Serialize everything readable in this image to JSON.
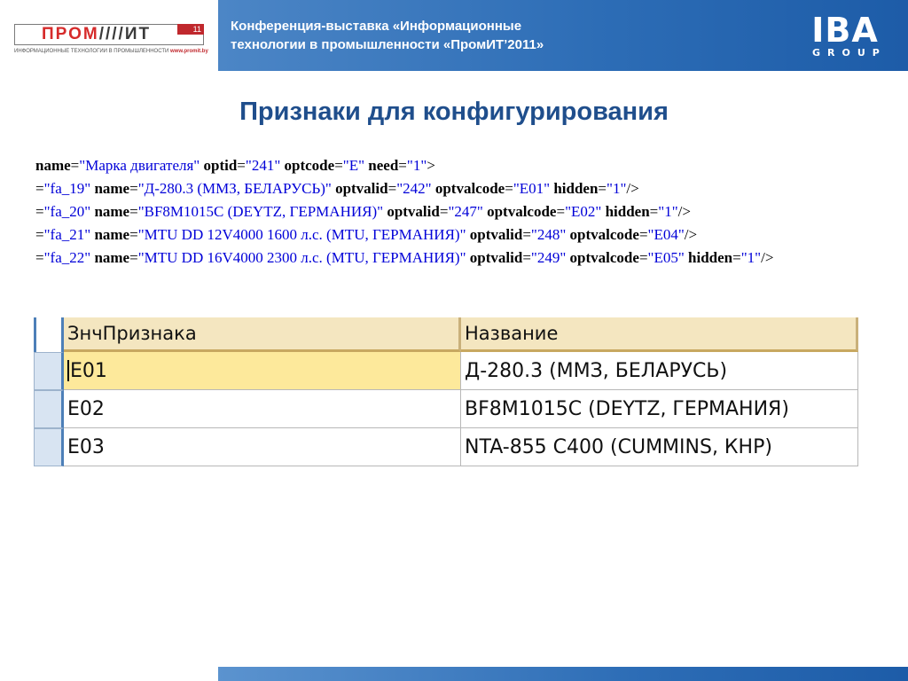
{
  "header": {
    "logo": {
      "word_left": "ПРОМ",
      "word_right": "ИТ",
      "badge": "11",
      "tagline": "ИНФОРМАЦИОННЫЕ ТЕХНОЛОГИИ В ПРОМЫШЛЕННОСТИ",
      "url": "www.promit.by"
    },
    "conference_line1": "Конференция-выставка «Информационные",
    "conference_line2": "технологии в промышленности «ПромИТ’2011»",
    "company_logo_main": "IBA",
    "company_logo_sub": "GROUP"
  },
  "title": "Признаки для конфигурирования",
  "xml_lines": [
    [
      {
        "t": "name",
        "k": "attr"
      },
      {
        "t": "=",
        "k": "pun"
      },
      {
        "t": "\"Марка двигателя\"",
        "k": "val"
      },
      {
        "t": " ",
        "k": "pun"
      },
      {
        "t": "optid",
        "k": "attr"
      },
      {
        "t": "=",
        "k": "pun"
      },
      {
        "t": "\"241\"",
        "k": "val"
      },
      {
        "t": " ",
        "k": "pun"
      },
      {
        "t": "optcode",
        "k": "attr"
      },
      {
        "t": "=",
        "k": "pun"
      },
      {
        "t": "\"E\"",
        "k": "val"
      },
      {
        "t": " ",
        "k": "pun"
      },
      {
        "t": "need",
        "k": "attr"
      },
      {
        "t": "=",
        "k": "pun"
      },
      {
        "t": "\"1\"",
        "k": "val"
      },
      {
        "t": ">",
        "k": "pun"
      }
    ],
    [
      {
        "t": "=",
        "k": "pun"
      },
      {
        "t": "\"fa_19\"",
        "k": "val"
      },
      {
        "t": " ",
        "k": "pun"
      },
      {
        "t": "name",
        "k": "attr"
      },
      {
        "t": "=",
        "k": "pun"
      },
      {
        "t": "\"Д-280.3 (ММЗ, БЕЛАРУСЬ)\"",
        "k": "val"
      },
      {
        "t": " ",
        "k": "pun"
      },
      {
        "t": "optvalid",
        "k": "attr"
      },
      {
        "t": "=",
        "k": "pun"
      },
      {
        "t": "\"242\"",
        "k": "val"
      },
      {
        "t": " ",
        "k": "pun"
      },
      {
        "t": "optvalcode",
        "k": "attr"
      },
      {
        "t": "=",
        "k": "pun"
      },
      {
        "t": "\"E01\"",
        "k": "val"
      },
      {
        "t": " ",
        "k": "pun"
      },
      {
        "t": "hidden",
        "k": "attr"
      },
      {
        "t": "=",
        "k": "pun"
      },
      {
        "t": "\"1\"",
        "k": "val"
      },
      {
        "t": "/>",
        "k": "pun"
      }
    ],
    [
      {
        "t": "=",
        "k": "pun"
      },
      {
        "t": "\"fa_20\"",
        "k": "val"
      },
      {
        "t": " ",
        "k": "pun"
      },
      {
        "t": "name",
        "k": "attr"
      },
      {
        "t": "=",
        "k": "pun"
      },
      {
        "t": "\"BF8M1015C (DEYTZ, ГЕРМАНИЯ)\"",
        "k": "val"
      },
      {
        "t": " ",
        "k": "pun"
      },
      {
        "t": "optvalid",
        "k": "attr"
      },
      {
        "t": "=",
        "k": "pun"
      },
      {
        "t": "\"247\"",
        "k": "val"
      },
      {
        "t": " ",
        "k": "pun"
      },
      {
        "t": "optvalcode",
        "k": "attr"
      },
      {
        "t": "=",
        "k": "pun"
      },
      {
        "t": "\"E02\"",
        "k": "val"
      },
      {
        "t": " ",
        "k": "pun"
      },
      {
        "t": "hidden",
        "k": "attr"
      },
      {
        "t": "=",
        "k": "pun"
      },
      {
        "t": "\"1\"",
        "k": "val"
      },
      {
        "t": "/>",
        "k": "pun"
      }
    ],
    [
      {
        "t": "=",
        "k": "pun"
      },
      {
        "t": "\"fa_21\"",
        "k": "val"
      },
      {
        "t": " ",
        "k": "pun"
      },
      {
        "t": "name",
        "k": "attr"
      },
      {
        "t": "=",
        "k": "pun"
      },
      {
        "t": "\"MTU DD 12V4000 1600 л.с. (MTU, ГЕРМАНИЯ)\"",
        "k": "val"
      },
      {
        "t": " ",
        "k": "pun"
      },
      {
        "t": "optvalid",
        "k": "attr"
      },
      {
        "t": "=",
        "k": "pun"
      },
      {
        "t": "\"248\"",
        "k": "val"
      },
      {
        "t": " ",
        "k": "pun"
      },
      {
        "t": "optvalcode",
        "k": "attr"
      },
      {
        "t": "=",
        "k": "pun"
      },
      {
        "t": "\"E04\"",
        "k": "val"
      },
      {
        "t": "/>",
        "k": "pun"
      }
    ],
    [
      {
        "t": "=",
        "k": "pun"
      },
      {
        "t": "\"fa_22\"",
        "k": "val"
      },
      {
        "t": " ",
        "k": "pun"
      },
      {
        "t": "name",
        "k": "attr"
      },
      {
        "t": "=",
        "k": "pun"
      },
      {
        "t": "\"MTU DD 16V4000 2300 л.с. (MTU, ГЕРМАНИЯ)\"",
        "k": "val"
      },
      {
        "t": " ",
        "k": "pun"
      },
      {
        "t": "optvalid",
        "k": "attr"
      },
      {
        "t": "=",
        "k": "pun"
      },
      {
        "t": "\"249\"",
        "k": "val"
      },
      {
        "t": " ",
        "k": "pun"
      },
      {
        "t": "optvalcode",
        "k": "attr"
      },
      {
        "t": "=",
        "k": "pun"
      },
      {
        "t": "\"E05\"",
        "k": "val"
      },
      {
        "t": " ",
        "k": "pun"
      },
      {
        "t": "hidden",
        "k": "attr"
      },
      {
        "t": "=",
        "k": "pun"
      },
      {
        "t": "\"1\"",
        "k": "val"
      },
      {
        "t": "/>",
        "k": "pun"
      }
    ]
  ],
  "grid": {
    "columns": [
      "ЗнчПризнака",
      "Название"
    ],
    "rows": [
      [
        "E01",
        "Д-280.3 (ММЗ, БЕЛАРУСЬ)"
      ],
      [
        "E02",
        "BF8M1015C (DEYTZ, ГЕРМАНИЯ)"
      ],
      [
        "E03",
        "NTA-855 C400 (CUMMINS, КНР)"
      ]
    ],
    "selected_row": 0
  },
  "colors": {
    "header_blue": "#2d6db6",
    "title_blue": "#1f4e8c",
    "xml_value_blue": "#0000d8",
    "grid_header_bg": "#f4e6c0",
    "grid_selected_bg": "#fde99b"
  }
}
